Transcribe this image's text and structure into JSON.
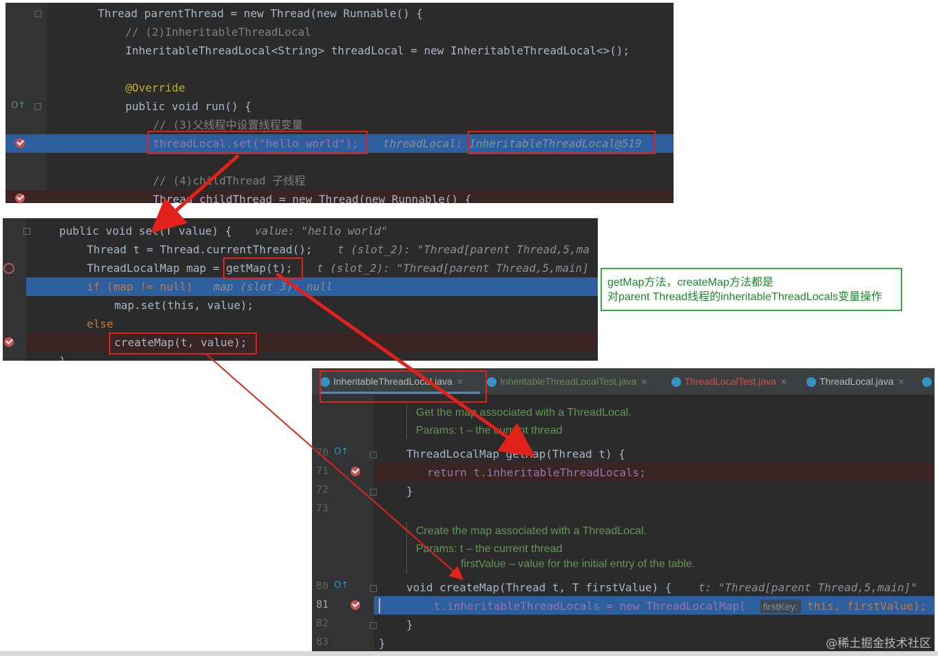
{
  "panel1": {
    "lines": [
      "Thread parentThread = new Thread(new Runnable() {",
      "// (2)InheritableThreadLocal",
      "InheritableThreadLocal<String> threadLocal = new InheritableThreadLocal<>();",
      "@Override",
      "public void run() {",
      "// (3)父线程中设置线程变量",
      "threadLocal.set(\"hello world\");",
      "threadLocal: InheritableThreadLocal@519",
      "// (4)childThread 子线程",
      "Thread childThread = new Thread(new Runnable() {"
    ]
  },
  "panel2": {
    "lines": [
      "public void set(T value) {",
      "value: \"hello world\"",
      "Thread t = Thread.currentThread();",
      "t (slot_2): \"Thread[parent Thread,5,ma",
      "ThreadLocalMap map = getMap(t);",
      "t (slot_2): \"Thread[parent Thread,5,main]",
      "if (map != null)",
      "map (slot_3): null",
      "map.set(this, value);",
      "else",
      "createMap(t, value);",
      "}"
    ]
  },
  "note": {
    "line1": "getMap方法，createMap方法都是",
    "line2": "对parent Thread线程的inheritableThreadLocals变量操作"
  },
  "panel3": {
    "tabs": [
      {
        "label": "InheritableThreadLocal.java",
        "color": "#bbbbbb"
      },
      {
        "label": "InheritableThreadLocalTest.java",
        "color": "#6a8759"
      },
      {
        "label": "ThreadLocalTest.java",
        "color": "#c75450"
      },
      {
        "label": "ThreadLocal.java",
        "color": "#bbbbbb"
      }
    ],
    "doc1": [
      "Get the map associated with a ThreadLocal.",
      "Params: t – the current thread"
    ],
    "line_numbers": [
      "70",
      "71",
      "72",
      "73",
      "80",
      "81",
      "82",
      "83"
    ],
    "code": [
      "ThreadLocalMap getMap(Thread t) {",
      "return t.inheritableThreadLocals;",
      "}",
      "void createMap(Thread t, T firstValue) {",
      "t: \"Thread[parent Thread,5,main]\"",
      "t.inheritableThreadLocals = new ThreadLocalMap(",
      "firstKey:",
      "this, firstValue);",
      "}",
      "}"
    ],
    "doc2": [
      "Create the map associated with a ThreadLocal.",
      "Params: t – the current thread",
      "firstValue – value for the initial entry of the table."
    ]
  },
  "watermark": "@稀土掘金技术社区",
  "colors": {
    "arrow": "#e0221b",
    "box": "#e0221b",
    "note_border": "#2fb33b",
    "breakpoint": "#c75450",
    "exec_line": "#2d5e9e"
  }
}
